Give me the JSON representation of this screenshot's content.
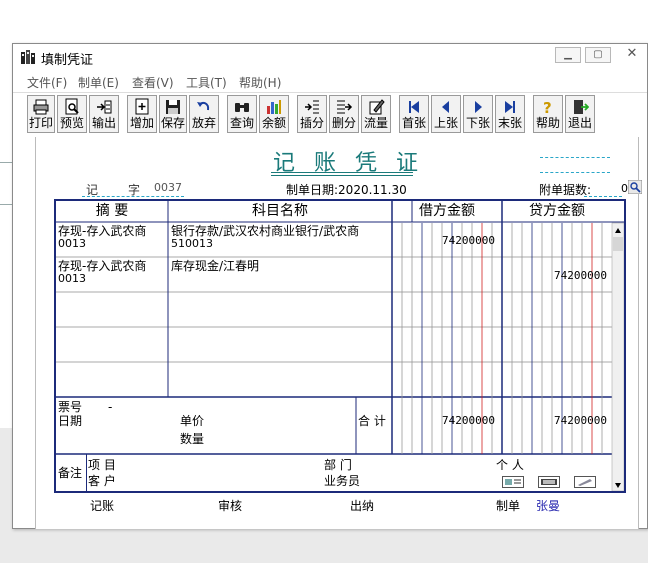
{
  "window": {
    "title": "填制凭证"
  },
  "menu": [
    "文件(F)",
    "制单(E)",
    "查看(V)",
    "工具(T)",
    "帮助(H)"
  ],
  "toolbar": {
    "print": "打印",
    "preview": "预览",
    "export": "输出",
    "add": "增加",
    "save": "保存",
    "discard": "放弃",
    "query": "查询",
    "balance": "余额",
    "insert_line": "插分",
    "delete_line": "删分",
    "cashflow": "流量",
    "first": "首张",
    "prev": "上张",
    "next": "下张",
    "last": "末张",
    "help": "帮助",
    "exit": "退出"
  },
  "voucher": {
    "title": "记 账 凭 证",
    "type_label": "记",
    "zi_label": "字",
    "number": "0037",
    "date_label": "制单日期:2020.11.30",
    "attachments_label": "附单据数:",
    "attachments_value": "0",
    "columns": {
      "summary": "摘 要",
      "account": "科目名称",
      "debit": "借方金额",
      "credit": "贷方金额"
    },
    "rows": [
      {
        "summary": "存现-存入武农商",
        "summary_sub": "0013",
        "account": "银行存款/武汉农村商业银行/武农商",
        "account_sub": "510013",
        "debit": "74200000",
        "credit": ""
      },
      {
        "summary": "存现-存入武农商",
        "summary_sub": "0013",
        "account": "库存现金/江春明",
        "account_sub": "",
        "debit": "",
        "credit": "74200000"
      }
    ],
    "info": {
      "ticket_label": "票号",
      "ticket_value": "-",
      "date_label": "日期",
      "price_label": "单价",
      "qty_label": "数量",
      "total_label": "合 计",
      "total_debit": "74200000",
      "total_credit": "74200000"
    },
    "notes": {
      "notes_label": "备注",
      "project_label": "项 目",
      "customer_label": "客 户",
      "dept_label": "部 门",
      "salesman_label": "业务员",
      "person_label": "个 人"
    },
    "footer": {
      "bookkeeping": "记账",
      "review": "审核",
      "cashier": "出纳",
      "maker_label": "制单",
      "maker_name": "张曼"
    },
    "colors": {
      "title": "#1a7a7a",
      "grid": "#1c2a7a",
      "red_line": "#d02020",
      "maker_name": "#2a2ab0"
    }
  }
}
